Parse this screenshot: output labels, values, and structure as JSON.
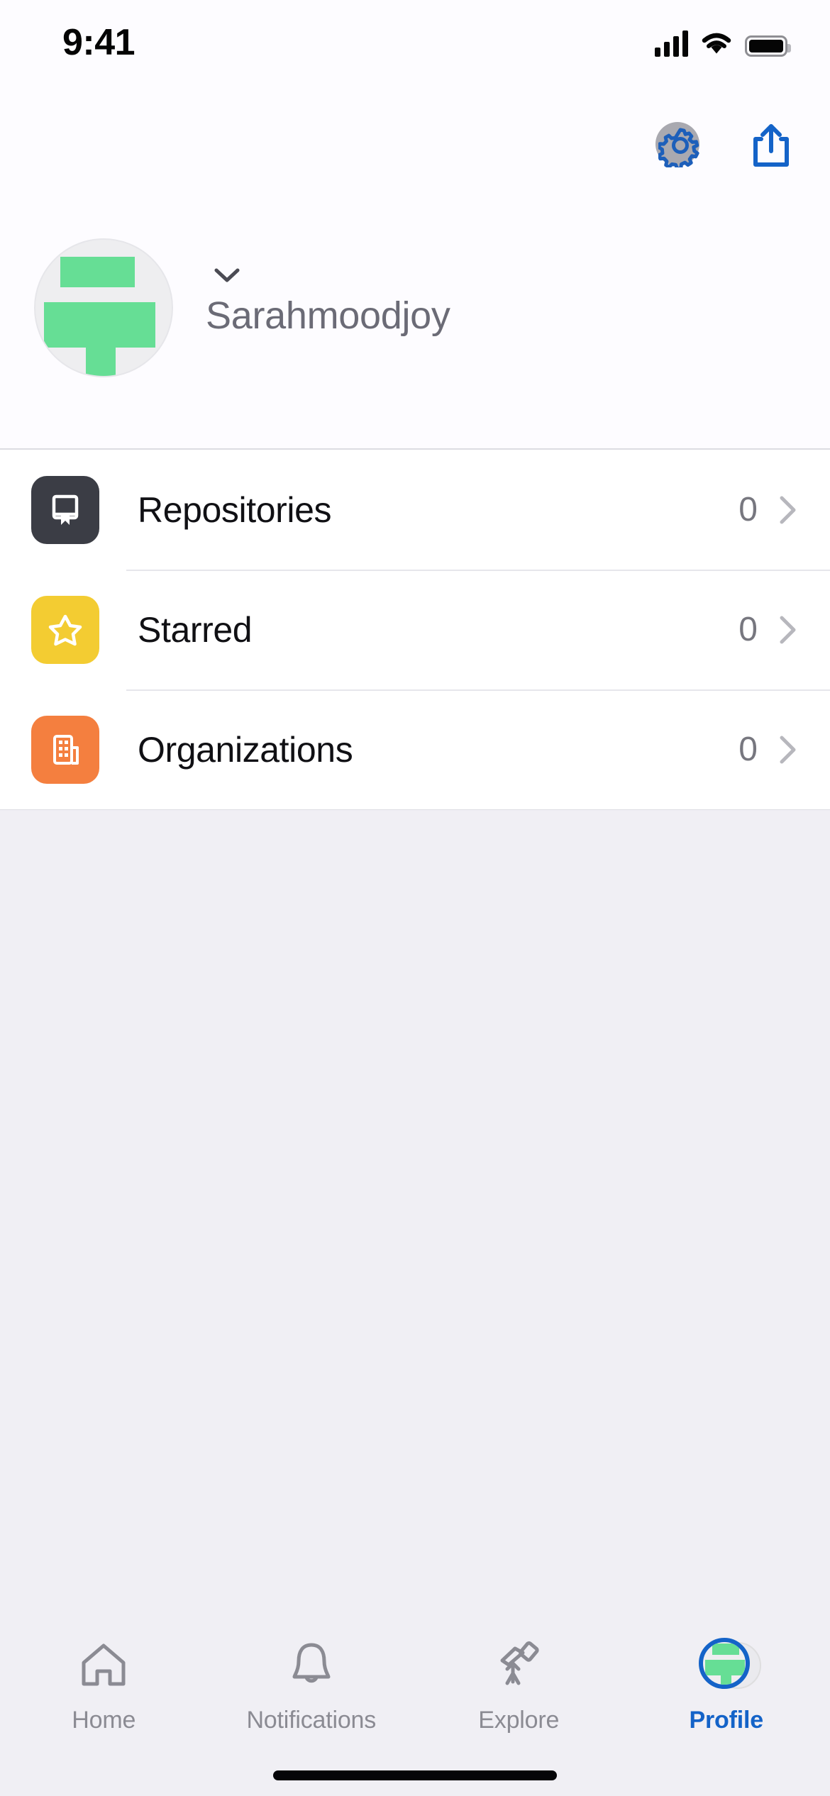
{
  "status_bar": {
    "time": "9:41",
    "icons": [
      "cellular-signal-icon",
      "wifi-icon",
      "battery-icon"
    ]
  },
  "header": {
    "settings_button": {
      "icon": "gear-icon",
      "label": "Settings",
      "highlighted": true
    },
    "share_button": {
      "icon": "share-icon",
      "label": "Share"
    },
    "accent_color": "#1463c8",
    "highlight_color": "#a9a9b0"
  },
  "profile": {
    "username": "Sarahmoodjoy",
    "avatar_icon": "avatar-identicon",
    "avatar_color": "#66de95",
    "avatar_bg": "#eeeef0",
    "dropdown_icon": "chevron-down-icon"
  },
  "list": {
    "rows": [
      {
        "label": "Repositories",
        "count": "0",
        "icon": "repo-icon",
        "icon_color": "#3b3d45"
      },
      {
        "label": "Starred",
        "count": "0",
        "icon": "star-icon",
        "icon_color": "#f3cc32"
      },
      {
        "label": "Organizations",
        "count": "0",
        "icon": "organization-icon",
        "icon_color": "#f47f3f"
      }
    ],
    "disclosure_icon": "chevron-right-icon",
    "background": "#ffffff"
  },
  "tab_bar": {
    "background": "#f0eff4",
    "active_color": "#1463c8",
    "inactive_color": "#8b8b93",
    "tabs": [
      {
        "label": "Home",
        "icon": "home-icon",
        "active": false
      },
      {
        "label": "Notifications",
        "icon": "bell-icon",
        "active": false
      },
      {
        "label": "Explore",
        "icon": "telescope-icon",
        "active": false
      },
      {
        "label": "Profile",
        "icon": "profile-avatar-icon",
        "active": true
      }
    ]
  },
  "home_indicator": {
    "name": "home-indicator"
  }
}
